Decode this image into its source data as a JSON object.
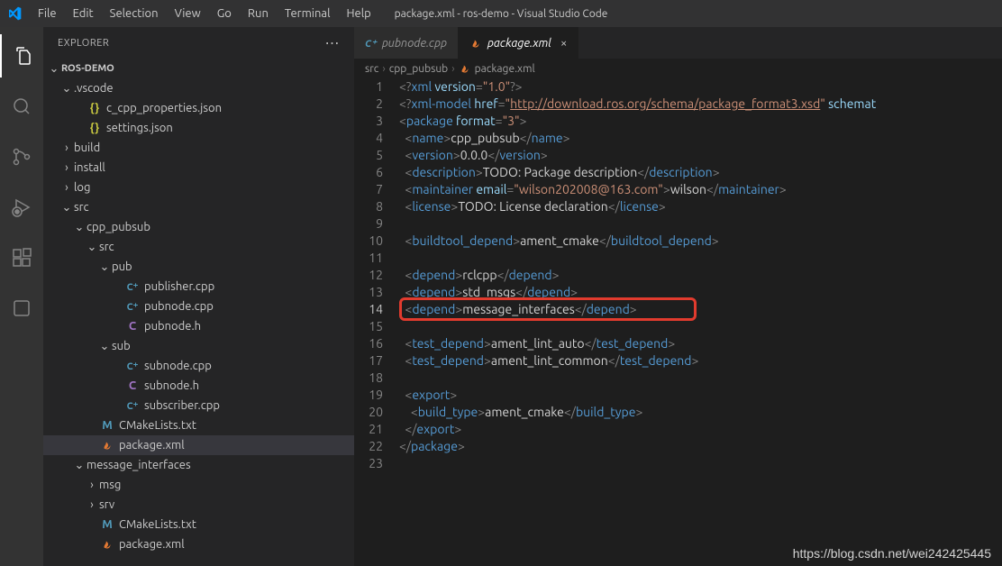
{
  "titlebar": {
    "title": "package.xml - ros-demo - Visual Studio Code",
    "menu": [
      "File",
      "Edit",
      "Selection",
      "View",
      "Go",
      "Run",
      "Terminal",
      "Help"
    ]
  },
  "activitybar": {
    "items": [
      "explorer",
      "search",
      "scm",
      "run-debug",
      "extensions",
      "more"
    ]
  },
  "explorer": {
    "title": "EXPLORER",
    "root": "ROS-DEMO",
    "tree": [
      {
        "depth": 1,
        "kind": "folder",
        "open": true,
        "name": ".vscode"
      },
      {
        "depth": 2,
        "kind": "file",
        "icon": "json",
        "name": "c_cpp_properties.json"
      },
      {
        "depth": 2,
        "kind": "file",
        "icon": "json",
        "name": "settings.json"
      },
      {
        "depth": 1,
        "kind": "folder",
        "open": false,
        "name": "build"
      },
      {
        "depth": 1,
        "kind": "folder",
        "open": false,
        "name": "install"
      },
      {
        "depth": 1,
        "kind": "folder",
        "open": false,
        "name": "log"
      },
      {
        "depth": 1,
        "kind": "folder",
        "open": true,
        "name": "src"
      },
      {
        "depth": 2,
        "kind": "folder",
        "open": true,
        "name": "cpp_pubsub"
      },
      {
        "depth": 3,
        "kind": "folder",
        "open": true,
        "name": "src"
      },
      {
        "depth": 4,
        "kind": "folder",
        "open": true,
        "name": "pub"
      },
      {
        "depth": 5,
        "kind": "file",
        "icon": "cpp",
        "name": "publisher.cpp"
      },
      {
        "depth": 5,
        "kind": "file",
        "icon": "cpp",
        "name": "pubnode.cpp"
      },
      {
        "depth": 5,
        "kind": "file",
        "icon": "h",
        "name": "pubnode.h"
      },
      {
        "depth": 4,
        "kind": "folder",
        "open": true,
        "name": "sub"
      },
      {
        "depth": 5,
        "kind": "file",
        "icon": "cpp",
        "name": "subnode.cpp"
      },
      {
        "depth": 5,
        "kind": "file",
        "icon": "h",
        "name": "subnode.h"
      },
      {
        "depth": 5,
        "kind": "file",
        "icon": "cpp",
        "name": "subscriber.cpp"
      },
      {
        "depth": 3,
        "kind": "file",
        "icon": "m",
        "name": "CMakeLists.txt"
      },
      {
        "depth": 3,
        "kind": "file",
        "icon": "xml",
        "name": "package.xml",
        "selected": true
      },
      {
        "depth": 2,
        "kind": "folder",
        "open": true,
        "name": "message_interfaces"
      },
      {
        "depth": 3,
        "kind": "folder",
        "open": false,
        "name": "msg"
      },
      {
        "depth": 3,
        "kind": "folder",
        "open": false,
        "name": "srv"
      },
      {
        "depth": 3,
        "kind": "file",
        "icon": "m",
        "name": "CMakeLists.txt"
      },
      {
        "depth": 3,
        "kind": "file",
        "icon": "xml",
        "name": "package.xml"
      }
    ]
  },
  "tabs": [
    {
      "icon": "cpp",
      "label": "pubnode.cpp",
      "active": false,
      "dirty": false
    },
    {
      "icon": "xml",
      "label": "package.xml",
      "active": true,
      "dirty": false,
      "closable": true
    }
  ],
  "breadcrumbs": [
    "src",
    "cpp_pubsub",
    "package.xml"
  ],
  "breadcrumb_icon": "xml",
  "code": {
    "current_line": 14,
    "lines": [
      {
        "n": 1,
        "segs": [
          {
            "t": "<?",
            "c": "pun"
          },
          {
            "t": "xml ",
            "c": "pi"
          },
          {
            "t": "version",
            "c": "attr"
          },
          {
            "t": "=",
            "c": "pun"
          },
          {
            "t": "\"1.0\"",
            "c": "str"
          },
          {
            "t": "?>",
            "c": "pun"
          }
        ]
      },
      {
        "n": 2,
        "segs": [
          {
            "t": "<?",
            "c": "pun"
          },
          {
            "t": "xml-model ",
            "c": "pi"
          },
          {
            "t": "href",
            "c": "attr"
          },
          {
            "t": "=",
            "c": "pun"
          },
          {
            "t": "\"",
            "c": "str"
          },
          {
            "t": "http://download.ros.org/schema/package_format3.xsd",
            "c": "url"
          },
          {
            "t": "\"",
            "c": "str"
          },
          {
            "t": " ",
            "c": "txt"
          },
          {
            "t": "schemat",
            "c": "attr"
          }
        ]
      },
      {
        "n": 3,
        "segs": [
          {
            "t": "<",
            "c": "pun"
          },
          {
            "t": "package ",
            "c": "tag"
          },
          {
            "t": "format",
            "c": "attr"
          },
          {
            "t": "=",
            "c": "pun"
          },
          {
            "t": "\"3\"",
            "c": "str"
          },
          {
            "t": ">",
            "c": "pun"
          }
        ]
      },
      {
        "n": 4,
        "indent": 1,
        "segs": [
          {
            "t": "<",
            "c": "pun"
          },
          {
            "t": "name",
            "c": "tag"
          },
          {
            "t": ">",
            "c": "pun"
          },
          {
            "t": "cpp_pubsub",
            "c": "txt"
          },
          {
            "t": "</",
            "c": "pun"
          },
          {
            "t": "name",
            "c": "close"
          },
          {
            "t": ">",
            "c": "pun"
          }
        ]
      },
      {
        "n": 5,
        "indent": 1,
        "segs": [
          {
            "t": "<",
            "c": "pun"
          },
          {
            "t": "version",
            "c": "tag"
          },
          {
            "t": ">",
            "c": "pun"
          },
          {
            "t": "0.0.0",
            "c": "txt"
          },
          {
            "t": "</",
            "c": "pun"
          },
          {
            "t": "version",
            "c": "close"
          },
          {
            "t": ">",
            "c": "pun"
          }
        ]
      },
      {
        "n": 6,
        "indent": 1,
        "segs": [
          {
            "t": "<",
            "c": "pun"
          },
          {
            "t": "description",
            "c": "tag"
          },
          {
            "t": ">",
            "c": "pun"
          },
          {
            "t": "TODO: Package description",
            "c": "txt"
          },
          {
            "t": "</",
            "c": "pun"
          },
          {
            "t": "description",
            "c": "close"
          },
          {
            "t": ">",
            "c": "pun"
          }
        ]
      },
      {
        "n": 7,
        "indent": 1,
        "segs": [
          {
            "t": "<",
            "c": "pun"
          },
          {
            "t": "maintainer ",
            "c": "tag"
          },
          {
            "t": "email",
            "c": "attr"
          },
          {
            "t": "=",
            "c": "pun"
          },
          {
            "t": "\"wilson202008@163.com\"",
            "c": "str"
          },
          {
            "t": ">",
            "c": "pun"
          },
          {
            "t": "wilson",
            "c": "txt"
          },
          {
            "t": "</",
            "c": "pun"
          },
          {
            "t": "maintainer",
            "c": "close"
          },
          {
            "t": ">",
            "c": "pun"
          }
        ]
      },
      {
        "n": 8,
        "indent": 1,
        "segs": [
          {
            "t": "<",
            "c": "pun"
          },
          {
            "t": "license",
            "c": "tag"
          },
          {
            "t": ">",
            "c": "pun"
          },
          {
            "t": "TODO: License declaration",
            "c": "txt"
          },
          {
            "t": "</",
            "c": "pun"
          },
          {
            "t": "license",
            "c": "close"
          },
          {
            "t": ">",
            "c": "pun"
          }
        ]
      },
      {
        "n": 9,
        "segs": []
      },
      {
        "n": 10,
        "indent": 1,
        "segs": [
          {
            "t": "<",
            "c": "pun"
          },
          {
            "t": "buildtool_depend",
            "c": "tag"
          },
          {
            "t": ">",
            "c": "pun"
          },
          {
            "t": "ament_cmake",
            "c": "txt"
          },
          {
            "t": "</",
            "c": "pun"
          },
          {
            "t": "buildtool_depend",
            "c": "close"
          },
          {
            "t": ">",
            "c": "pun"
          }
        ]
      },
      {
        "n": 11,
        "segs": []
      },
      {
        "n": 12,
        "indent": 1,
        "segs": [
          {
            "t": "<",
            "c": "pun"
          },
          {
            "t": "depend",
            "c": "tag"
          },
          {
            "t": ">",
            "c": "pun"
          },
          {
            "t": "rclcpp",
            "c": "txt"
          },
          {
            "t": "</",
            "c": "pun"
          },
          {
            "t": "depend",
            "c": "close"
          },
          {
            "t": ">",
            "c": "pun"
          }
        ]
      },
      {
        "n": 13,
        "indent": 1,
        "segs": [
          {
            "t": "<",
            "c": "pun"
          },
          {
            "t": "depend",
            "c": "tag"
          },
          {
            "t": ">",
            "c": "pun"
          },
          {
            "t": "std_msgs",
            "c": "txt"
          },
          {
            "t": "</",
            "c": "pun"
          },
          {
            "t": "depend",
            "c": "close"
          },
          {
            "t": ">",
            "c": "pun"
          }
        ]
      },
      {
        "n": 14,
        "indent": 1,
        "segs": [
          {
            "t": "<",
            "c": "pun"
          },
          {
            "t": "depend",
            "c": "tag"
          },
          {
            "t": ">",
            "c": "pun"
          },
          {
            "t": "message_interfaces",
            "c": "txt"
          },
          {
            "t": "</",
            "c": "pun"
          },
          {
            "t": "depend",
            "c": "close"
          },
          {
            "t": ">",
            "c": "pun"
          }
        ]
      },
      {
        "n": 15,
        "segs": []
      },
      {
        "n": 16,
        "indent": 1,
        "segs": [
          {
            "t": "<",
            "c": "pun"
          },
          {
            "t": "test_depend",
            "c": "tag"
          },
          {
            "t": ">",
            "c": "pun"
          },
          {
            "t": "ament_lint_auto",
            "c": "txt"
          },
          {
            "t": "</",
            "c": "pun"
          },
          {
            "t": "test_depend",
            "c": "close"
          },
          {
            "t": ">",
            "c": "pun"
          }
        ]
      },
      {
        "n": 17,
        "indent": 1,
        "segs": [
          {
            "t": "<",
            "c": "pun"
          },
          {
            "t": "test_depend",
            "c": "tag"
          },
          {
            "t": ">",
            "c": "pun"
          },
          {
            "t": "ament_lint_common",
            "c": "txt"
          },
          {
            "t": "</",
            "c": "pun"
          },
          {
            "t": "test_depend",
            "c": "close"
          },
          {
            "t": ">",
            "c": "pun"
          }
        ]
      },
      {
        "n": 18,
        "segs": []
      },
      {
        "n": 19,
        "indent": 1,
        "segs": [
          {
            "t": "<",
            "c": "pun"
          },
          {
            "t": "export",
            "c": "tag"
          },
          {
            "t": ">",
            "c": "pun"
          }
        ]
      },
      {
        "n": 20,
        "indent": 2,
        "segs": [
          {
            "t": "<",
            "c": "pun"
          },
          {
            "t": "build_type",
            "c": "tag"
          },
          {
            "t": ">",
            "c": "pun"
          },
          {
            "t": "ament_cmake",
            "c": "txt"
          },
          {
            "t": "</",
            "c": "pun"
          },
          {
            "t": "build_type",
            "c": "close"
          },
          {
            "t": ">",
            "c": "pun"
          }
        ]
      },
      {
        "n": 21,
        "indent": 1,
        "segs": [
          {
            "t": "</",
            "c": "pun"
          },
          {
            "t": "export",
            "c": "close"
          },
          {
            "t": ">",
            "c": "pun"
          }
        ]
      },
      {
        "n": 22,
        "segs": [
          {
            "t": "</",
            "c": "pun"
          },
          {
            "t": "package",
            "c": "close"
          },
          {
            "t": ">",
            "c": "pun"
          }
        ]
      },
      {
        "n": 23,
        "segs": []
      }
    ]
  },
  "highlight_line": 14,
  "watermark": "https://blog.csdn.net/wei242425445"
}
